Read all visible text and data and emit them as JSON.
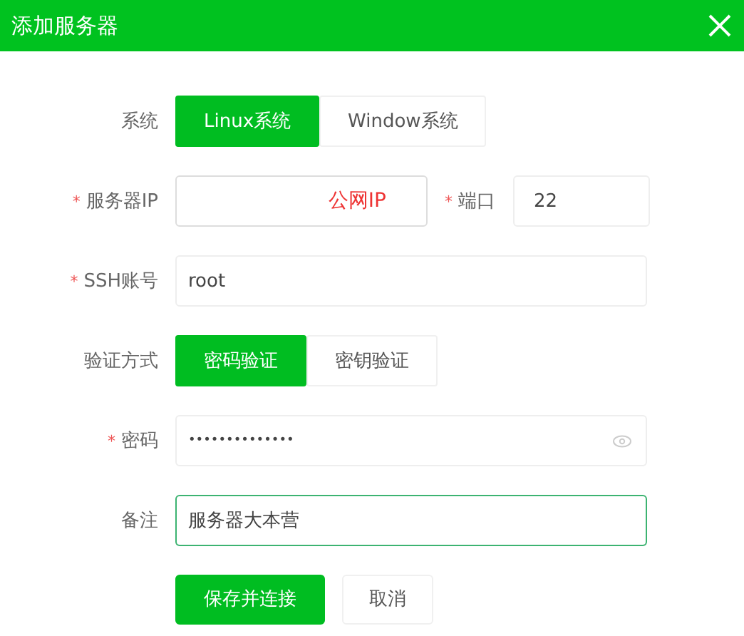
{
  "dialog": {
    "title": "添加服务器"
  },
  "fields": [
    {
      "kind": "segmented",
      "label": "系统",
      "options": [
        {
          "label": "Linux系统",
          "selected": true
        },
        {
          "label": "Window系统",
          "selected": false
        }
      ]
    },
    {
      "kind": "text",
      "label": "服务器IP",
      "mark": "*",
      "annotation": "公网IP",
      "focused": false,
      "side": {
        "label": "端口",
        "mark": "*",
        "value": "22"
      }
    },
    {
      "kind": "text",
      "label": "SSH账号",
      "mark": "*",
      "value": "root",
      "focused": false
    },
    {
      "kind": "segmented",
      "label": "验证方式",
      "options": [
        {
          "label": "密码验证",
          "selected": true
        },
        {
          "label": "密钥验证",
          "selected": false
        }
      ]
    },
    {
      "kind": "password",
      "label": "密码",
      "mark": "*",
      "value": "••••••••••••••",
      "focused": false
    },
    {
      "kind": "text",
      "label": "备注",
      "value": "服务器大本营",
      "focused": true
    }
  ],
  "buttons": [
    {
      "label": "保存并连接",
      "primary": true
    },
    {
      "label": "取消",
      "primary": false
    }
  ]
}
